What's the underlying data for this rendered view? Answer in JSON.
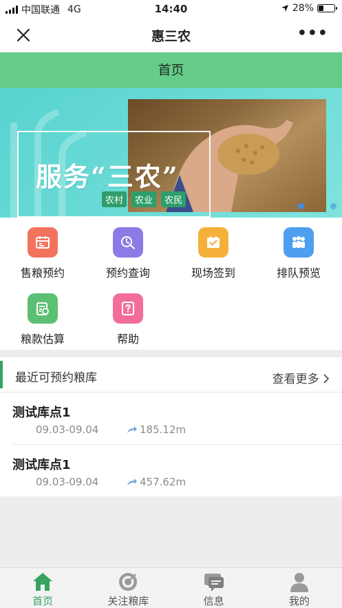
{
  "status_bar": {
    "carrier": "中国联通",
    "network": "4G",
    "time": "14:40",
    "battery": "28%",
    "battery_level": 0.28
  },
  "nav": {
    "title": "惠三农",
    "close_icon": "close-icon",
    "more_icon": "more-icon"
  },
  "page_header": {
    "title": "首页"
  },
  "banner": {
    "slogan": "服务“三农”",
    "tags": [
      "农村",
      "农业",
      "农民"
    ]
  },
  "menu": {
    "items": [
      {
        "label": "售粮预约",
        "icon": "calendar-icon",
        "color": "#f2735d"
      },
      {
        "label": "预约查询",
        "icon": "clock-search-icon",
        "color": "#8e7ae6"
      },
      {
        "label": "现场签到",
        "icon": "checkin-icon",
        "color": "#f5b03c"
      },
      {
        "label": "排队预览",
        "icon": "queue-people-icon",
        "color": "#4e9ff0"
      },
      {
        "label": "粮款估算",
        "icon": "calculator-icon",
        "color": "#5cc074"
      },
      {
        "label": "帮助",
        "icon": "help-icon",
        "color": "#f36d9a"
      }
    ]
  },
  "recent": {
    "title": "最近可预约粮库",
    "more_label": "查看更多",
    "items": [
      {
        "name": "测试库点1",
        "date": "09.03-09.04",
        "distance": "185.12m"
      },
      {
        "name": "测试库点1",
        "date": "09.03-09.04",
        "distance": "457.62m"
      }
    ]
  },
  "tabbar": {
    "tabs": [
      {
        "label": "首页",
        "icon": "home-icon",
        "active": true
      },
      {
        "label": "关注粮库",
        "icon": "target-icon",
        "active": false
      },
      {
        "label": "信息",
        "icon": "message-icon",
        "active": false
      },
      {
        "label": "我的",
        "icon": "user-icon",
        "active": false
      }
    ]
  },
  "colors": {
    "accent": "#36a362",
    "header_bg": "#66cc8a"
  }
}
